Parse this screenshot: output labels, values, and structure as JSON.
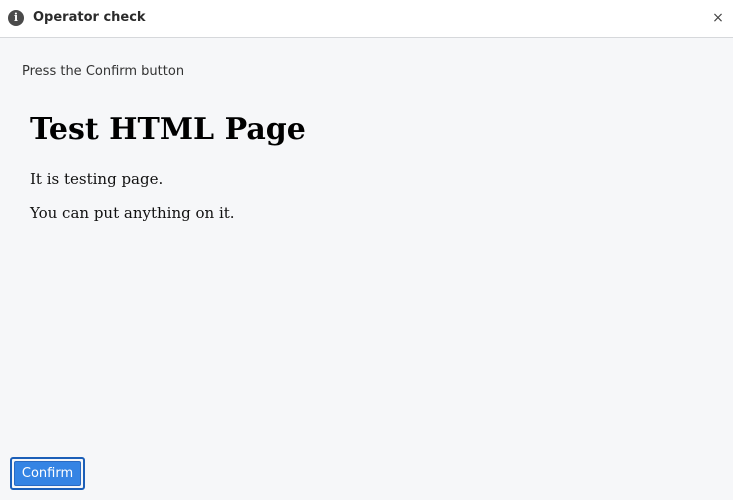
{
  "window": {
    "title": "Operator check",
    "info_icon": "info-icon",
    "info_glyph": "i",
    "close_glyph": "×",
    "close_icon": "close-icon"
  },
  "instruction": "Press the Confirm button",
  "content": {
    "heading": "Test HTML Page",
    "paragraph_1": "It is testing page.",
    "paragraph_2": "You can put anything on it."
  },
  "buttons": {
    "confirm_label": "Confirm"
  },
  "colors": {
    "accent": "#3584e4",
    "accent_border": "#1c5fb8",
    "background": "#f6f7f9",
    "titlebar": "#ffffff"
  }
}
